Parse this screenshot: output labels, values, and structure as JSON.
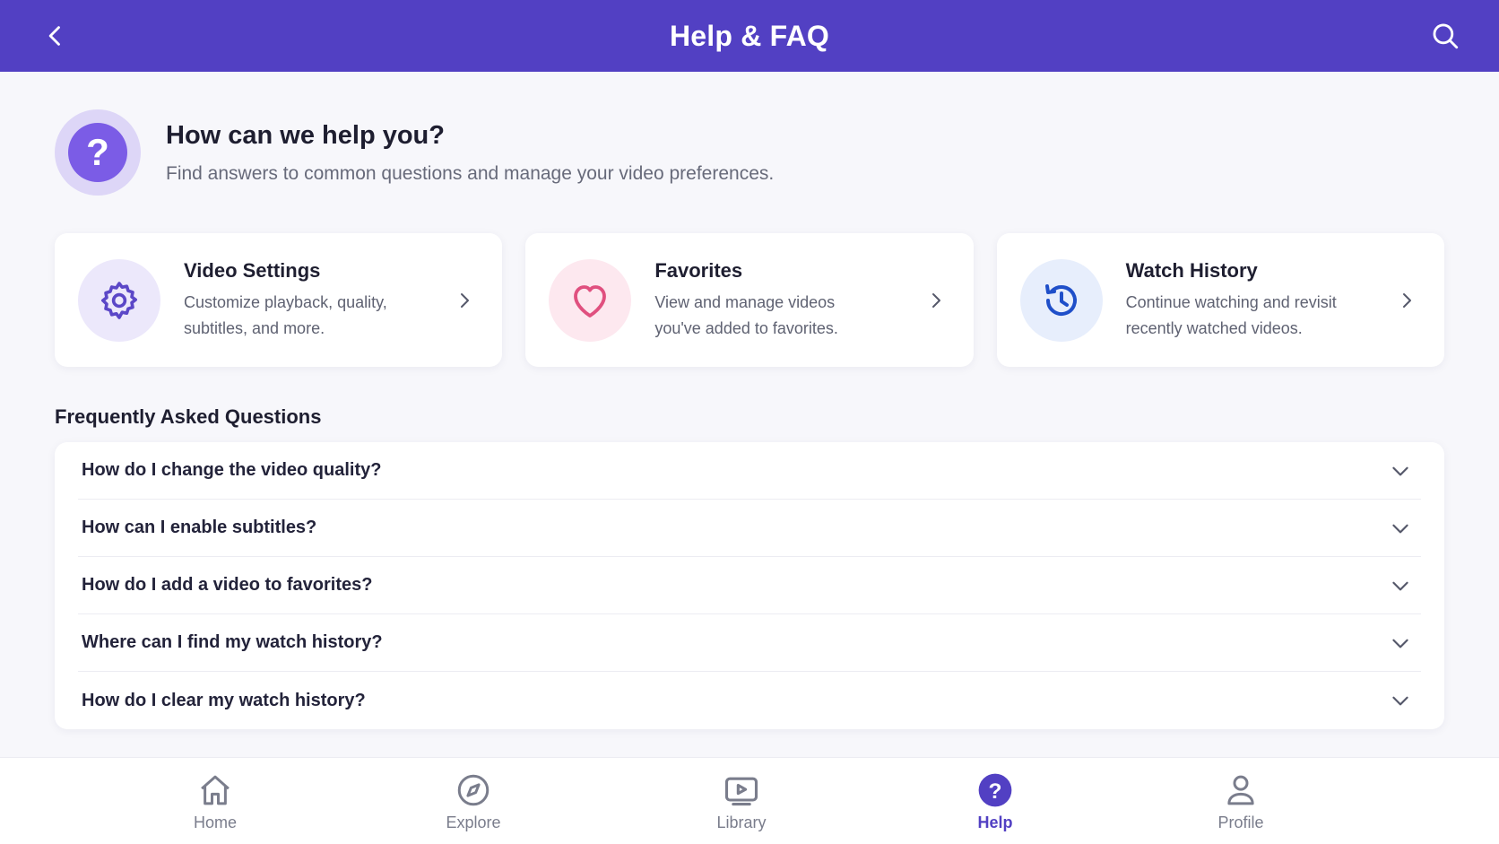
{
  "header": {
    "title": "Help & FAQ",
    "back_icon": "chevron-left-icon",
    "search_icon": "search-icon",
    "background_color": "#5240c3"
  },
  "intro": {
    "icon": "question-icon",
    "icon_glyph": "?",
    "title": "How can we help you?",
    "subtitle": "Find answers to common questions and manage your video preferences."
  },
  "cards": [
    {
      "title": "Video Settings",
      "description": "Customize playback, quality, subtitles, and more.",
      "icon": "gear-icon",
      "icon_color": "#5b47c7",
      "icon_bg": "#ece8fb"
    },
    {
      "title": "Favorites",
      "description": "View and manage videos you've added to favorites.",
      "icon": "heart-icon",
      "icon_color": "#e0507f",
      "icon_bg": "#fde8ef"
    },
    {
      "title": "Watch History",
      "description": "Continue watching and revisit recently watched videos.",
      "icon": "history-icon",
      "icon_color": "#1f4fc9",
      "icon_bg": "#e7eefc"
    }
  ],
  "faq": {
    "heading": "Frequently Asked Questions",
    "items": [
      "How do I change the video quality?",
      "How can I enable subtitles?",
      "How do I add a video to favorites?",
      "Where can I find my watch history?",
      "How do I clear my watch history?"
    ]
  },
  "bottom_nav": {
    "items": [
      {
        "label": "Home",
        "icon": "home-icon",
        "active": false
      },
      {
        "label": "Explore",
        "icon": "compass-icon",
        "active": false
      },
      {
        "label": "Library",
        "icon": "play-icon",
        "active": false
      },
      {
        "label": "Help",
        "icon": "question-icon",
        "active": true
      },
      {
        "label": "Profile",
        "icon": "user-icon",
        "active": false
      }
    ],
    "active_color": "#5240c3"
  }
}
